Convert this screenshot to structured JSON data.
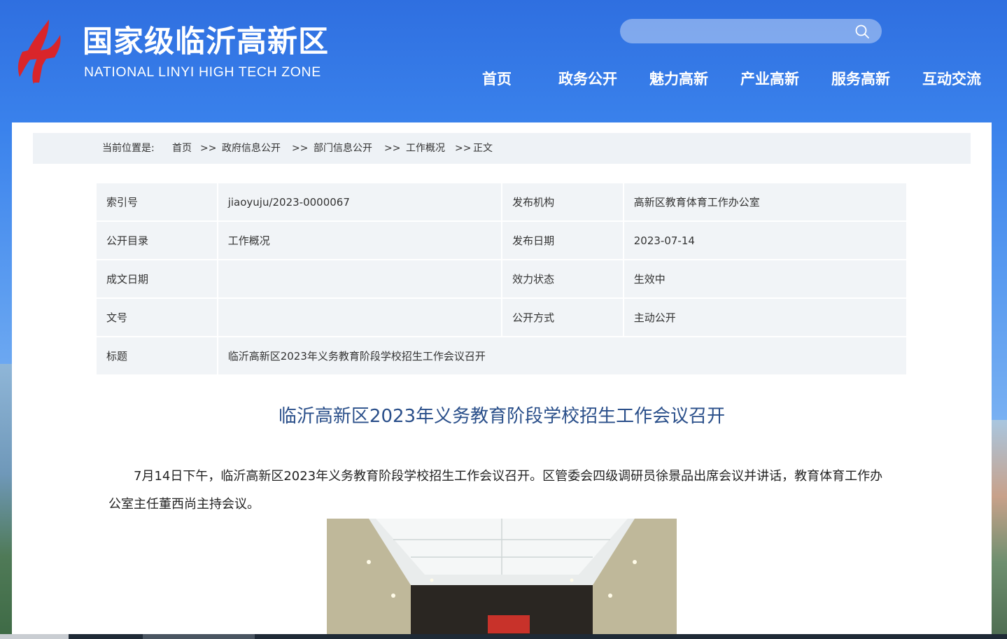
{
  "header": {
    "site_title": "国家级临沂高新区",
    "site_subtitle": "NATIONAL LINYI HIGH TECH ZONE",
    "search_placeholder": "",
    "logo_color": "#d9252a"
  },
  "nav": {
    "items": [
      {
        "label": "首页"
      },
      {
        "label": "政务公开"
      },
      {
        "label": "魅力高新"
      },
      {
        "label": "产业高新"
      },
      {
        "label": "服务高新"
      },
      {
        "label": "互动交流"
      }
    ]
  },
  "breadcrumb": {
    "prefix": "当前位置是:",
    "items": [
      "首页",
      "政府信息公开",
      "部门信息公开",
      "工作概况"
    ],
    "separator": ">>",
    "current": "正文"
  },
  "meta": {
    "index_label": "索引号",
    "index_value": "jiaoyuju/2023-0000067",
    "publisher_label": "发布机构",
    "publisher_value": "高新区教育体育工作办公室",
    "catalog_label": "公开目录",
    "catalog_value": "工作概况",
    "pubdate_label": "发布日期",
    "pubdate_value": "2023-07-14",
    "docdate_label": "成文日期",
    "docdate_value": "",
    "status_label": "效力状态",
    "status_value": "生效中",
    "docno_label": "文号",
    "docno_value": "",
    "method_label": "公开方式",
    "method_value": "主动公开",
    "title_label": "标题",
    "title_value": "临沂高新区2023年义务教育阶段学校招生工作会议召开"
  },
  "article": {
    "title": "临沂高新区2023年义务教育阶段学校招生工作会议召开",
    "paragraph": "7月14日下午，临沂高新区2023年义务教育阶段学校招生工作会议召开。区管委会四级调研员徐景品出席会议并讲话，教育体育工作办公室主任董西尚主持会议。"
  },
  "colors": {
    "header_blue": "#2f6fe0",
    "title_blue": "#2a4f8a",
    "table_bg": "#f1f4f7"
  }
}
